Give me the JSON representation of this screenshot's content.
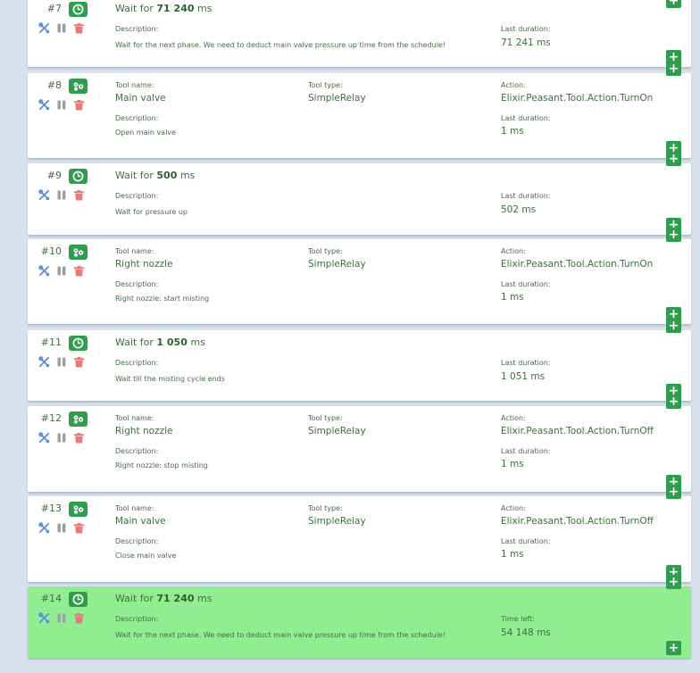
{
  "labels": {
    "wait_prefix": "Wait for",
    "wait_unit": "ms",
    "tool_name": "Tool name:",
    "tool_type": "Tool type:",
    "action": "Action:",
    "description": "Description:",
    "last_duration": "Last duration:",
    "time_left": "Time left:",
    "add": "+"
  },
  "colors": {
    "background": "#d9e1ec",
    "card": "#ffffff",
    "active_card": "#90ee90",
    "accent_green": "#2e9e4e",
    "edit_icon": "#5b8fcf",
    "pause_icon": "#9aa0a6",
    "delete_icon": "#ea7a7a"
  },
  "steps": [
    {
      "number": "#7",
      "kind": "wait",
      "type_icon": "clock-icon",
      "wait_amount": "71 240",
      "description": "Wait for the next phase. We need to deduct main valve pressure up time from the schedule!",
      "duration_label": "Last duration:",
      "duration": "71 241 ms",
      "active": false
    },
    {
      "number": "#8",
      "kind": "tool",
      "type_icon": "gears-icon",
      "tool_name": "Main valve",
      "tool_type": "SimpleRelay",
      "action": "Elixir.Peasant.Tool.Action.TurnOn",
      "description": "Open main valve",
      "duration_label": "Last duration:",
      "duration": "1 ms",
      "active": false
    },
    {
      "number": "#9",
      "kind": "wait",
      "type_icon": "clock-icon",
      "wait_amount": "500",
      "description": "Wait for pressure up",
      "duration_label": "Last duration:",
      "duration": "502 ms",
      "active": false
    },
    {
      "number": "#10",
      "kind": "tool",
      "type_icon": "gears-icon",
      "tool_name": "Right nozzle",
      "tool_type": "SimpleRelay",
      "action": "Elixir.Peasant.Tool.Action.TurnOn",
      "description": "Right nozzle: start misting",
      "duration_label": "Last duration:",
      "duration": "1 ms",
      "active": false
    },
    {
      "number": "#11",
      "kind": "wait",
      "type_icon": "clock-icon",
      "wait_amount": "1 050",
      "description": "Wait till the misting cycle ends",
      "duration_label": "Last duration:",
      "duration": "1 051 ms",
      "active": false
    },
    {
      "number": "#12",
      "kind": "tool",
      "type_icon": "gears-icon",
      "tool_name": "Right nozzle",
      "tool_type": "SimpleRelay",
      "action": "Elixir.Peasant.Tool.Action.TurnOff",
      "description": "Right nozzle: stop misting",
      "duration_label": "Last duration:",
      "duration": "1 ms",
      "active": false
    },
    {
      "number": "#13",
      "kind": "tool",
      "type_icon": "gears-icon",
      "tool_name": "Main valve",
      "tool_type": "SimpleRelay",
      "action": "Elixir.Peasant.Tool.Action.TurnOff",
      "description": "Close main valve",
      "duration_label": "Last duration:",
      "duration": "1 ms",
      "active": false
    },
    {
      "number": "#14",
      "kind": "wait",
      "type_icon": "clock-icon",
      "wait_amount": "71 240",
      "description": "Wait for the next phase. We need to deduct main valve pressure up time from the schedule!",
      "duration_label": "Time left:",
      "duration": "54 148 ms",
      "active": true
    }
  ]
}
